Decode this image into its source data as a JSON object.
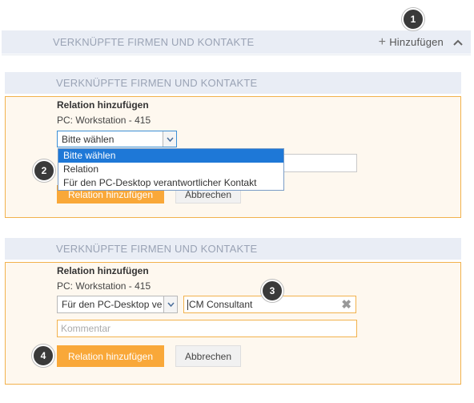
{
  "section1": {
    "title": "VERKNÜPFTE FIRMEN UND KONTAKTE",
    "add_label": "Hinzufügen",
    "add_icon": "plus-icon",
    "collapse_icon": "chevron-up-icon"
  },
  "section2": {
    "title": "VERKNÜPFTE FIRMEN UND KONTAKTE",
    "heading": "Relation hinzufügen",
    "subtitle": "PC: Workstation - 415",
    "select_value": "Bitte wählen",
    "dropdown_options": [
      "Bitte wählen",
      "Relation",
      "Für den PC-Desktop verantwortlicher Kontakt"
    ],
    "hidden_btn_primary": "Relation hinzufügen",
    "hidden_btn_secondary": "Abbrechen"
  },
  "section3": {
    "title": "VERKNÜPFTE FIRMEN UND KONTAKTE",
    "heading": "Relation hinzufügen",
    "subtitle": "PC: Workstation - 415",
    "select_value": "Für den PC-Desktop ve",
    "contact_value": "CM Consultant",
    "comment_placeholder": "Kommentar",
    "submit_label": "Relation hinzufügen",
    "cancel_label": "Abbrechen"
  },
  "badges": [
    "1",
    "2",
    "3",
    "4"
  ],
  "colors": {
    "accent": "#f9a839",
    "panel_border": "#f2b24d",
    "header_bg": "#e9edf5",
    "selection": "#1e78d7"
  }
}
